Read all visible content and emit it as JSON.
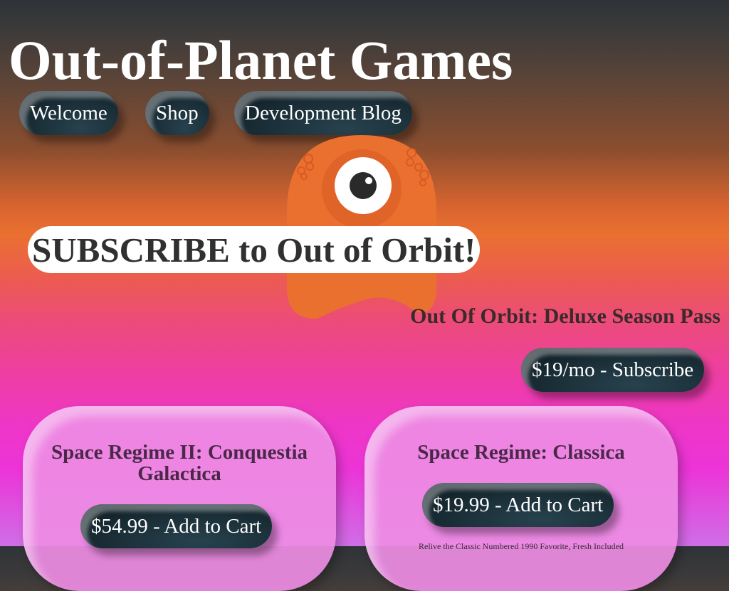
{
  "site": {
    "title": "Out-of-Planet Games"
  },
  "nav": {
    "items": [
      {
        "label": "Welcome"
      },
      {
        "label": "Shop"
      },
      {
        "label": "Development Blog"
      }
    ]
  },
  "promo": {
    "banner": "SUBSCRIBE to Out of Orbit!",
    "pass_title": "Out Of Orbit: Deluxe Season Pass",
    "subscribe_label": "$19/mo - Subscribe"
  },
  "products": [
    {
      "title": "Space Regime II: Conquestia Galactica",
      "cart_label": "$54.99 - Add to Cart"
    },
    {
      "title": "Space Regime: Classica",
      "cart_label": "$19.99 - Add to Cart",
      "blurb": "Relive the Classic Numbered 1990 Favorite, Fresh Included"
    }
  ],
  "colors": {
    "button_dark": "#1a2e37",
    "mascot_orange": "#ea7030",
    "card_pink": "#ee8ce4",
    "title_white": "#ffffff"
  },
  "icons": {
    "mascot": "one-eyed-alien-mascot"
  }
}
